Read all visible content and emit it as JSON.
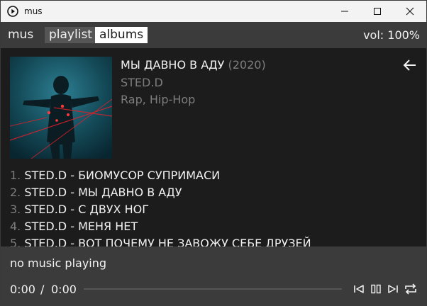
{
  "window": {
    "title": "mus",
    "app_icon": "play-circle-icon",
    "controls": [
      "minimize-icon",
      "maximize-icon",
      "close-icon"
    ]
  },
  "nav": {
    "brand": "mus",
    "items": [
      {
        "label": "playlist",
        "active": false
      },
      {
        "label": "albums",
        "active": true
      }
    ],
    "volume": "vol: 100%"
  },
  "album": {
    "title": "МЫ ДАВНО В АДУ",
    "year": "(2020)",
    "artist": "STED.D",
    "genres": "Rap, Hip-Hop",
    "back_icon": "arrow-left-icon"
  },
  "tracks": [
    {
      "num": "1.",
      "title": "STED.D - БИОМУСОР СУПРИМАСИ"
    },
    {
      "num": "2.",
      "title": "STED.D - МЫ ДАВНО В АДУ"
    },
    {
      "num": "3.",
      "title": "STED.D - С ДВУХ НОГ"
    },
    {
      "num": "4.",
      "title": "STED.D - МЕНЯ НЕТ"
    },
    {
      "num": "5.",
      "title": "STED.D - ВОТ ПОЧЕМУ НЕ ЗАВОЖУ СЕБЕ ДРУЗЕЙ"
    }
  ],
  "player": {
    "status": "no music playing",
    "current_time": "0:00",
    "separator": "/",
    "total_time": "0:00",
    "progress": 0,
    "controls": [
      "skip-back-icon",
      "pause-icon",
      "skip-forward-icon",
      "repeat-icon"
    ]
  },
  "colors": {
    "background": "#1c1c1c",
    "bar": "#3b3b3b",
    "muted_text": "#7d7d7d",
    "active_tab_bg": "#ffffff"
  }
}
